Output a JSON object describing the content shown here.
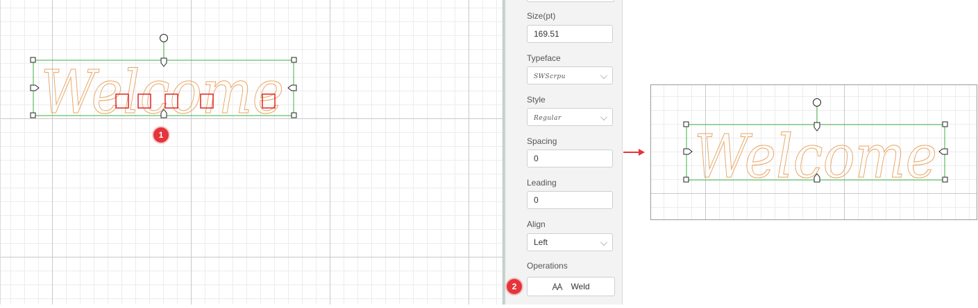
{
  "panel": {
    "size_label": "Size(pt)",
    "size_value": "169.51",
    "typeface_label": "Typeface",
    "typeface_value": "SWScrpu",
    "style_label": "Style",
    "style_value": "Regular",
    "spacing_label": "Spacing",
    "spacing_value": "0",
    "leading_label": "Leading",
    "leading_value": "0",
    "align_label": "Align",
    "align_value": "Left",
    "operations_label": "Operations",
    "weld_label": "Weld"
  },
  "canvas": {
    "text_before": "Welcome",
    "text_after": "Welcome",
    "overlap_markers": 5
  },
  "badges": [
    "1",
    "2"
  ],
  "colors": {
    "outline": "#e8a25c",
    "selection": "#3cb043",
    "marker": "#e02424",
    "badge": "#e5343a",
    "arrow": "#e5343a"
  },
  "icons": {
    "weld": "weld-icon",
    "rotate": "rotate-handle-icon",
    "arrow": "arrow-right-icon"
  }
}
